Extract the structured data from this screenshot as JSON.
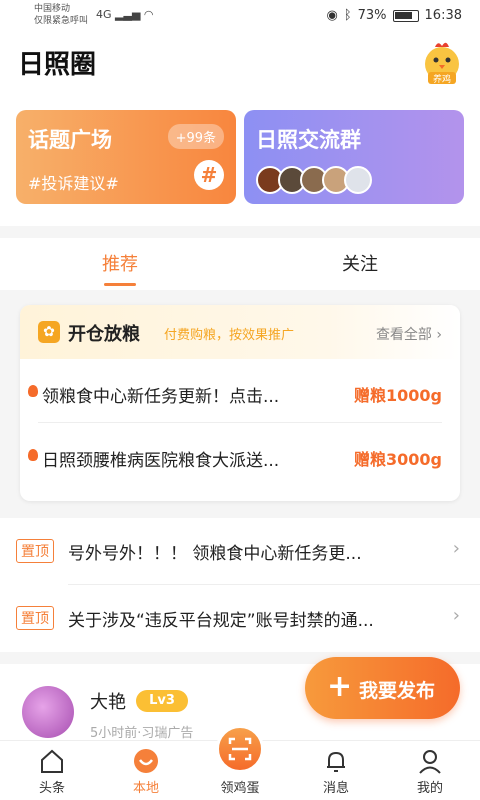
{
  "status_bar": {
    "carrier": "中国移动",
    "carrier_sub": "仅限紧急呼叫",
    "signal": "4G",
    "battery": "73%",
    "time": "16:38"
  },
  "header": {
    "title": "日照圈",
    "mascot_text": "养鸡"
  },
  "cards": {
    "topic": {
      "title": "话题广场",
      "badge": "+99条",
      "sub": "#投诉建议#",
      "icon": "#"
    },
    "group": {
      "title": "日照交流群"
    }
  },
  "tabs": [
    {
      "label": "推荐"
    },
    {
      "label": "关注"
    }
  ],
  "grain": {
    "title": "开仓放粮",
    "subtitle": "付费购粮，按效果推广",
    "more": "查看全部",
    "items": [
      {
        "text": "领粮食中心新任务更新！点击...",
        "reward": "赠粮1000g"
      },
      {
        "text": "日照颈腰椎病医院粮食大派送...",
        "reward": "赠粮3000g"
      }
    ]
  },
  "pinned": {
    "tag": "置顶",
    "items": [
      {
        "text": "号外号外！！！ 领粮食中心新任务更..."
      },
      {
        "text": "关于涉及“违反平台规定”账号封禁的通..."
      }
    ]
  },
  "post": {
    "author": "大艳",
    "level": "Lv3",
    "meta": "5小时前·习瑞广告"
  },
  "publish": {
    "label": "我要发布",
    "plus": "+"
  },
  "nav": [
    {
      "label": "头条"
    },
    {
      "label": "本地"
    },
    {
      "label": "领鸡蛋"
    },
    {
      "label": "消息"
    },
    {
      "label": "我的"
    }
  ],
  "colors": {
    "accent": "#f5803a",
    "purple": "#9a92f0",
    "gold": "#f5a623"
  }
}
